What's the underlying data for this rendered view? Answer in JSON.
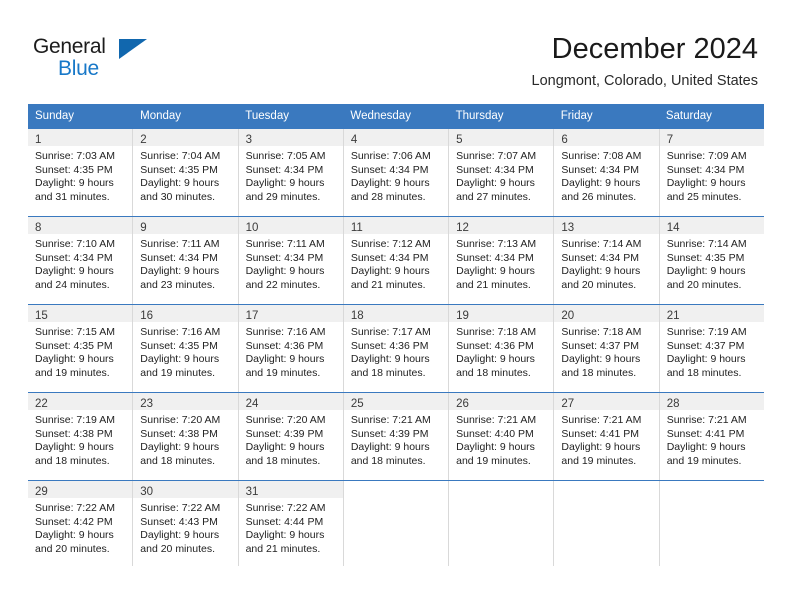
{
  "brand": {
    "name_top": "General",
    "name_bottom": "Blue",
    "triangle_icon": "triangle-icon",
    "accent_color": "#1878c8",
    "triangle_color": "#1167ae"
  },
  "header": {
    "title": "December 2024",
    "subtitle": "Longmont, Colorado, United States"
  },
  "calendar": {
    "header_bg": "#3a79bf",
    "daynum_bg": "#f0f0f0",
    "weekdays": [
      "Sunday",
      "Monday",
      "Tuesday",
      "Wednesday",
      "Thursday",
      "Friday",
      "Saturday"
    ],
    "weeks": [
      [
        {
          "day": "1",
          "sunrise": "Sunrise: 7:03 AM",
          "sunset": "Sunset: 4:35 PM",
          "daylight1": "Daylight: 9 hours",
          "daylight2": "and 31 minutes."
        },
        {
          "day": "2",
          "sunrise": "Sunrise: 7:04 AM",
          "sunset": "Sunset: 4:35 PM",
          "daylight1": "Daylight: 9 hours",
          "daylight2": "and 30 minutes."
        },
        {
          "day": "3",
          "sunrise": "Sunrise: 7:05 AM",
          "sunset": "Sunset: 4:34 PM",
          "daylight1": "Daylight: 9 hours",
          "daylight2": "and 29 minutes."
        },
        {
          "day": "4",
          "sunrise": "Sunrise: 7:06 AM",
          "sunset": "Sunset: 4:34 PM",
          "daylight1": "Daylight: 9 hours",
          "daylight2": "and 28 minutes."
        },
        {
          "day": "5",
          "sunrise": "Sunrise: 7:07 AM",
          "sunset": "Sunset: 4:34 PM",
          "daylight1": "Daylight: 9 hours",
          "daylight2": "and 27 minutes."
        },
        {
          "day": "6",
          "sunrise": "Sunrise: 7:08 AM",
          "sunset": "Sunset: 4:34 PM",
          "daylight1": "Daylight: 9 hours",
          "daylight2": "and 26 minutes."
        },
        {
          "day": "7",
          "sunrise": "Sunrise: 7:09 AM",
          "sunset": "Sunset: 4:34 PM",
          "daylight1": "Daylight: 9 hours",
          "daylight2": "and 25 minutes."
        }
      ],
      [
        {
          "day": "8",
          "sunrise": "Sunrise: 7:10 AM",
          "sunset": "Sunset: 4:34 PM",
          "daylight1": "Daylight: 9 hours",
          "daylight2": "and 24 minutes."
        },
        {
          "day": "9",
          "sunrise": "Sunrise: 7:11 AM",
          "sunset": "Sunset: 4:34 PM",
          "daylight1": "Daylight: 9 hours",
          "daylight2": "and 23 minutes."
        },
        {
          "day": "10",
          "sunrise": "Sunrise: 7:11 AM",
          "sunset": "Sunset: 4:34 PM",
          "daylight1": "Daylight: 9 hours",
          "daylight2": "and 22 minutes."
        },
        {
          "day": "11",
          "sunrise": "Sunrise: 7:12 AM",
          "sunset": "Sunset: 4:34 PM",
          "daylight1": "Daylight: 9 hours",
          "daylight2": "and 21 minutes."
        },
        {
          "day": "12",
          "sunrise": "Sunrise: 7:13 AM",
          "sunset": "Sunset: 4:34 PM",
          "daylight1": "Daylight: 9 hours",
          "daylight2": "and 21 minutes."
        },
        {
          "day": "13",
          "sunrise": "Sunrise: 7:14 AM",
          "sunset": "Sunset: 4:34 PM",
          "daylight1": "Daylight: 9 hours",
          "daylight2": "and 20 minutes."
        },
        {
          "day": "14",
          "sunrise": "Sunrise: 7:14 AM",
          "sunset": "Sunset: 4:35 PM",
          "daylight1": "Daylight: 9 hours",
          "daylight2": "and 20 minutes."
        }
      ],
      [
        {
          "day": "15",
          "sunrise": "Sunrise: 7:15 AM",
          "sunset": "Sunset: 4:35 PM",
          "daylight1": "Daylight: 9 hours",
          "daylight2": "and 19 minutes."
        },
        {
          "day": "16",
          "sunrise": "Sunrise: 7:16 AM",
          "sunset": "Sunset: 4:35 PM",
          "daylight1": "Daylight: 9 hours",
          "daylight2": "and 19 minutes."
        },
        {
          "day": "17",
          "sunrise": "Sunrise: 7:16 AM",
          "sunset": "Sunset: 4:36 PM",
          "daylight1": "Daylight: 9 hours",
          "daylight2": "and 19 minutes."
        },
        {
          "day": "18",
          "sunrise": "Sunrise: 7:17 AM",
          "sunset": "Sunset: 4:36 PM",
          "daylight1": "Daylight: 9 hours",
          "daylight2": "and 18 minutes."
        },
        {
          "day": "19",
          "sunrise": "Sunrise: 7:18 AM",
          "sunset": "Sunset: 4:36 PM",
          "daylight1": "Daylight: 9 hours",
          "daylight2": "and 18 minutes."
        },
        {
          "day": "20",
          "sunrise": "Sunrise: 7:18 AM",
          "sunset": "Sunset: 4:37 PM",
          "daylight1": "Daylight: 9 hours",
          "daylight2": "and 18 minutes."
        },
        {
          "day": "21",
          "sunrise": "Sunrise: 7:19 AM",
          "sunset": "Sunset: 4:37 PM",
          "daylight1": "Daylight: 9 hours",
          "daylight2": "and 18 minutes."
        }
      ],
      [
        {
          "day": "22",
          "sunrise": "Sunrise: 7:19 AM",
          "sunset": "Sunset: 4:38 PM",
          "daylight1": "Daylight: 9 hours",
          "daylight2": "and 18 minutes."
        },
        {
          "day": "23",
          "sunrise": "Sunrise: 7:20 AM",
          "sunset": "Sunset: 4:38 PM",
          "daylight1": "Daylight: 9 hours",
          "daylight2": "and 18 minutes."
        },
        {
          "day": "24",
          "sunrise": "Sunrise: 7:20 AM",
          "sunset": "Sunset: 4:39 PM",
          "daylight1": "Daylight: 9 hours",
          "daylight2": "and 18 minutes."
        },
        {
          "day": "25",
          "sunrise": "Sunrise: 7:21 AM",
          "sunset": "Sunset: 4:39 PM",
          "daylight1": "Daylight: 9 hours",
          "daylight2": "and 18 minutes."
        },
        {
          "day": "26",
          "sunrise": "Sunrise: 7:21 AM",
          "sunset": "Sunset: 4:40 PM",
          "daylight1": "Daylight: 9 hours",
          "daylight2": "and 19 minutes."
        },
        {
          "day": "27",
          "sunrise": "Sunrise: 7:21 AM",
          "sunset": "Sunset: 4:41 PM",
          "daylight1": "Daylight: 9 hours",
          "daylight2": "and 19 minutes."
        },
        {
          "day": "28",
          "sunrise": "Sunrise: 7:21 AM",
          "sunset": "Sunset: 4:41 PM",
          "daylight1": "Daylight: 9 hours",
          "daylight2": "and 19 minutes."
        }
      ],
      [
        {
          "day": "29",
          "sunrise": "Sunrise: 7:22 AM",
          "sunset": "Sunset: 4:42 PM",
          "daylight1": "Daylight: 9 hours",
          "daylight2": "and 20 minutes."
        },
        {
          "day": "30",
          "sunrise": "Sunrise: 7:22 AM",
          "sunset": "Sunset: 4:43 PM",
          "daylight1": "Daylight: 9 hours",
          "daylight2": "and 20 minutes."
        },
        {
          "day": "31",
          "sunrise": "Sunrise: 7:22 AM",
          "sunset": "Sunset: 4:44 PM",
          "daylight1": "Daylight: 9 hours",
          "daylight2": "and 21 minutes."
        },
        {
          "day": "",
          "sunrise": "",
          "sunset": "",
          "daylight1": "",
          "daylight2": ""
        },
        {
          "day": "",
          "sunrise": "",
          "sunset": "",
          "daylight1": "",
          "daylight2": ""
        },
        {
          "day": "",
          "sunrise": "",
          "sunset": "",
          "daylight1": "",
          "daylight2": ""
        },
        {
          "day": "",
          "sunrise": "",
          "sunset": "",
          "daylight1": "",
          "daylight2": ""
        }
      ]
    ]
  }
}
